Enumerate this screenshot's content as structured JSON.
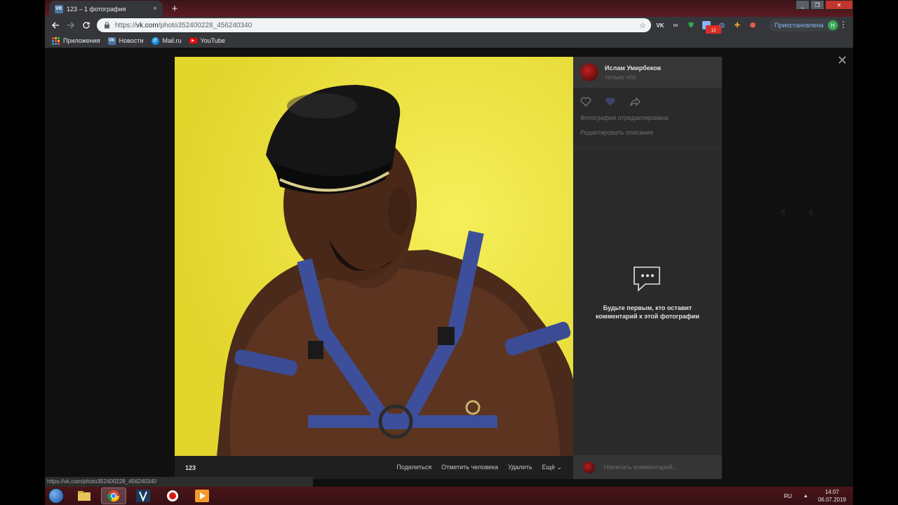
{
  "browser": {
    "tab": {
      "title": "123 – 1 фотография",
      "favicon": "vk-icon",
      "close": "×"
    },
    "newtab": "+",
    "window_controls": {
      "minimize": "_",
      "maximize": "❐",
      "close": "✕"
    },
    "url": {
      "scheme": "https://",
      "host": "vk.com",
      "path": "/photo352400228_456240340"
    },
    "profile": {
      "label": "Приостановлена",
      "initial": "Н"
    },
    "bookmarks": [
      {
        "label": "Приложения",
        "icon": "apps-grid-icon",
        "color": "#e94335"
      },
      {
        "label": "Новости",
        "icon": "vk-icon",
        "color": "#4a76a8"
      },
      {
        "label": "Mail.ru",
        "icon": "mailru-icon",
        "color": "#168de2"
      },
      {
        "label": "YouTube",
        "icon": "youtube-icon",
        "color": "#ff0000"
      }
    ],
    "status_url": "https://vk.com/photo352400228_456240340"
  },
  "viewer": {
    "caption": "123",
    "actions": [
      "Поделиться",
      "Отметить человека",
      "Удалить",
      "Ещё ⌄"
    ],
    "author": {
      "name": "Ислам Умирбеков",
      "time": "только что"
    },
    "links": [
      "Фотография отредактирована",
      "Редактировать описание"
    ],
    "empty_comments": "Будьте первым, кто оставит комментарий к этой фотографии",
    "comment_placeholder": "Написать комментарий...",
    "close": "✕"
  },
  "taskbar": {
    "lang": "RU",
    "time": "14:07",
    "date": "06.07.2019",
    "tray_arrow": "▲",
    "items": [
      "explorer-icon",
      "chrome-icon",
      "vegas-icon",
      "recorder-icon",
      "media-icon"
    ]
  },
  "colors": {
    "vk_blue": "#4a76a8",
    "photo_bg": "#ece23a",
    "panel": "#2a2a2a"
  }
}
